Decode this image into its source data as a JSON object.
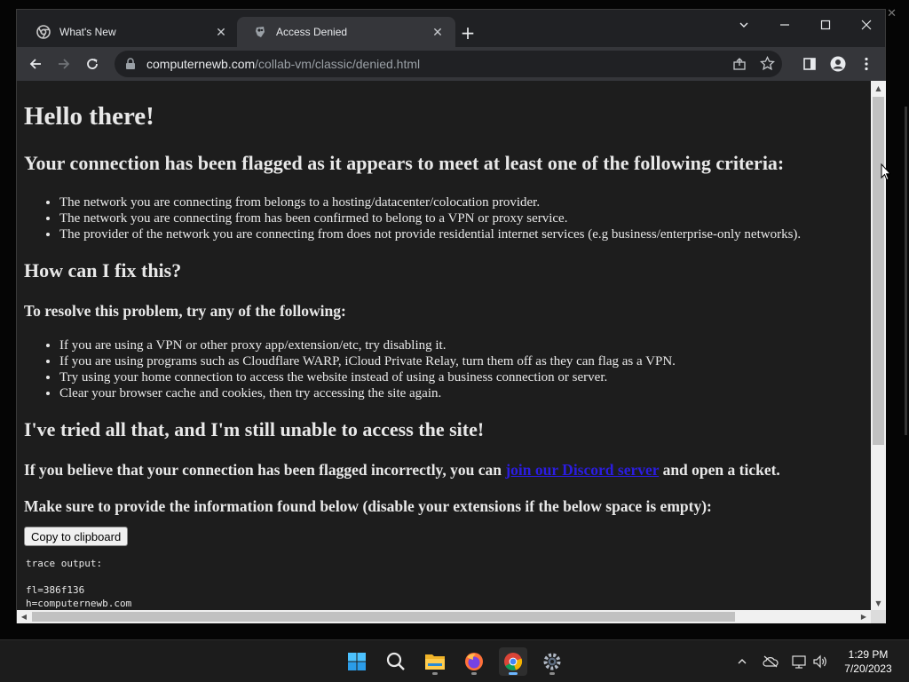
{
  "browser": {
    "tabs": [
      {
        "title": "What's New",
        "icon": "chrome-icon",
        "active": false
      },
      {
        "title": "Access Denied",
        "icon": "collabvm-icon",
        "active": true
      }
    ],
    "new_tab_label": "+",
    "url_host": "computernewb.com",
    "url_path": "/collab-vm/classic/denied.html"
  },
  "page": {
    "heading_main": "Hello there!",
    "heading_flagged": "Your connection has been flagged as it appears to meet at least one of the following criteria:",
    "criteria": [
      "The network you are connecting from belongs to a hosting/datacenter/colocation provider.",
      "The network you are connecting from has been confirmed to belong to a VPN or proxy service.",
      "The provider of the network you are connecting from does not provide residential internet services (e.g business/enterprise-only networks)."
    ],
    "heading_fix": "How can I fix this?",
    "resolve_intro": "To resolve this problem, try any of the following:",
    "fixes": [
      "If you are using a VPN or other proxy app/extension/etc, try disabling it.",
      "If you are using programs such as Cloudflare WARP, iCloud Private Relay, turn them off as they can flag as a VPN.",
      "Try using your home connection to access the website instead of using a business connection or server.",
      "Clear your browser cache and cookies, then try accessing the site again."
    ],
    "heading_tried": "I've tried all that, and I'm still unable to access the site!",
    "believe_prefix": "If you believe that your connection has been flagged incorrectly, you can ",
    "discord_link": "join our Discord server",
    "believe_suffix": " and open a ticket.",
    "provide_info": "Make sure to provide the information found below (disable your extensions if the below space is empty):",
    "copy_button": "Copy to clipboard",
    "trace_label": "trace output:",
    "trace_lines": [
      "fl=386f136",
      "h=computernewb.com"
    ]
  },
  "taskbar": {
    "apps": [
      "start-icon",
      "search-icon",
      "file-explorer-icon",
      "firefox-icon",
      "chrome-icon",
      "settings-icon"
    ],
    "time": "1:29 PM",
    "date": "7/20/2023"
  },
  "colors": {
    "page_bg": "#1d1d1d",
    "link": "#2b1de0",
    "chrome_dark": "#202124",
    "chrome_toolbar": "#35363a"
  }
}
